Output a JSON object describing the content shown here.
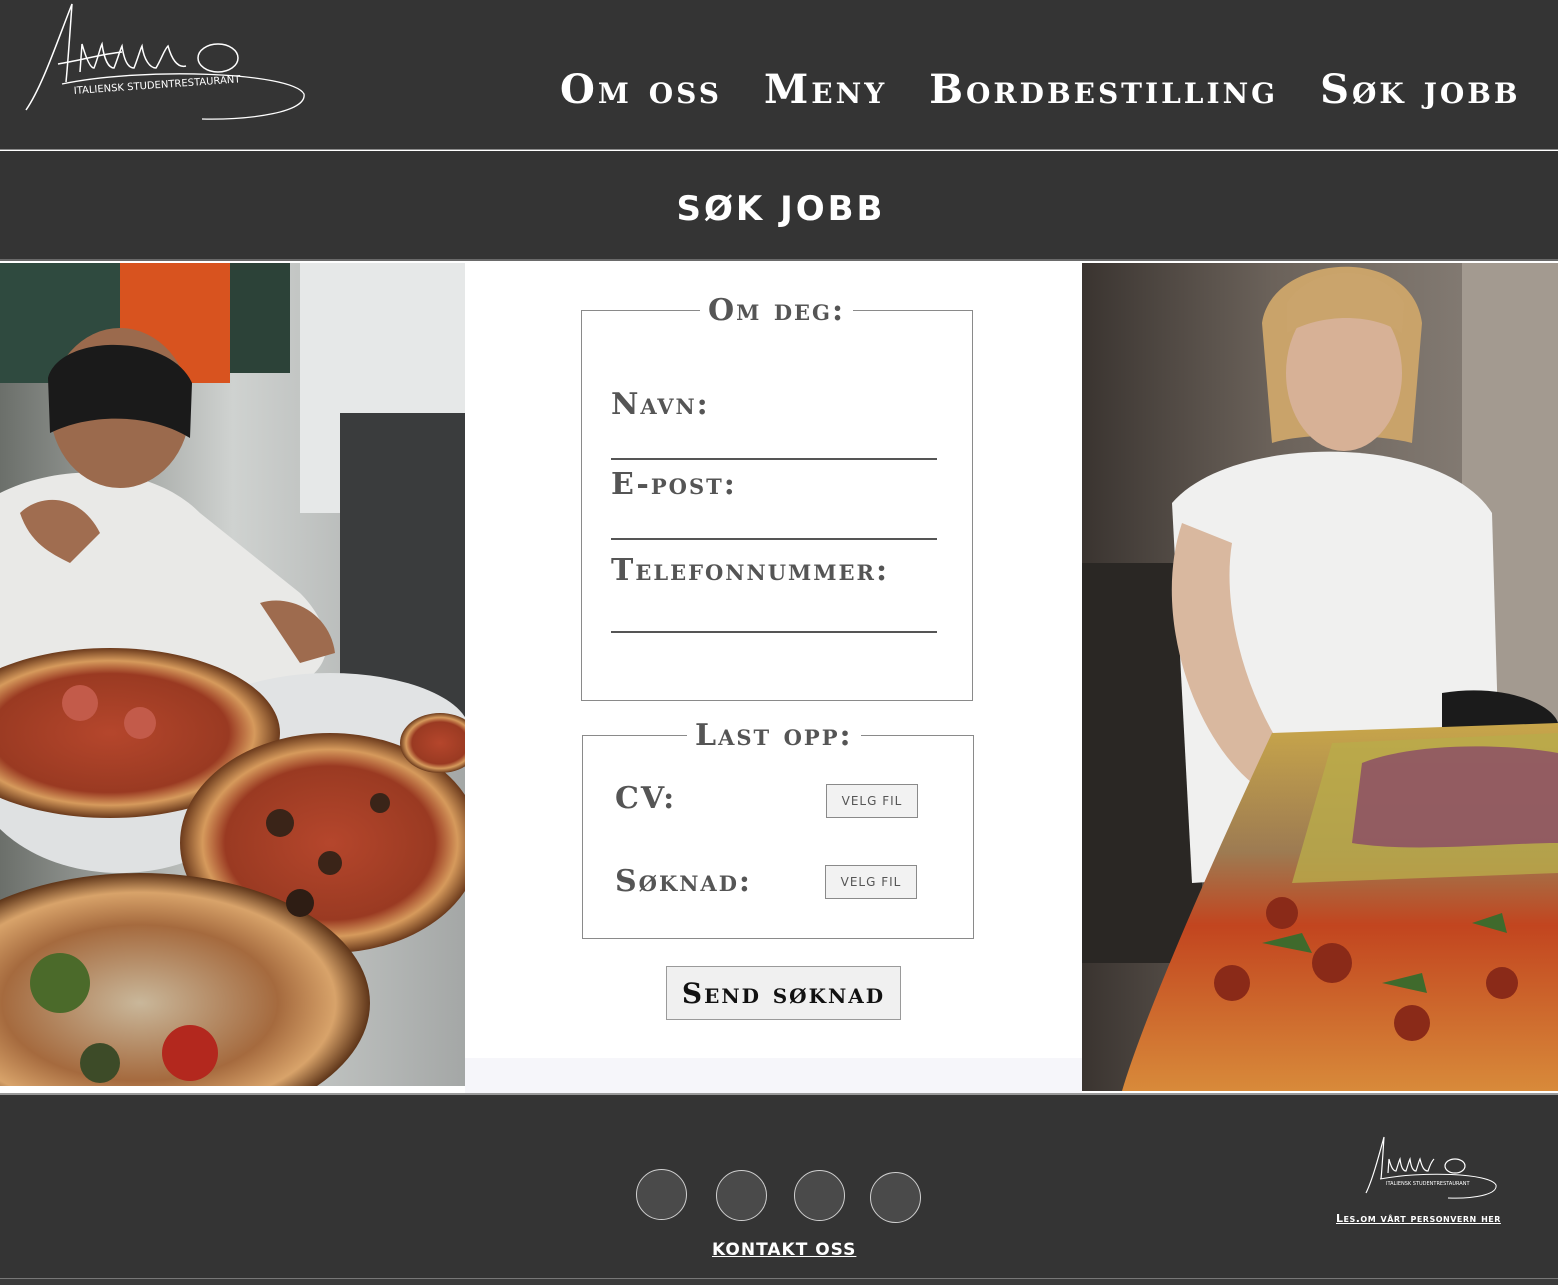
{
  "header": {
    "logo": {
      "brand": "Ahuuuo",
      "tagline": "ITALIENSK STUDENTRESTAURANT"
    },
    "nav": [
      {
        "label": "Om oss"
      },
      {
        "label": "Meny"
      },
      {
        "label": "Bordbestilling"
      },
      {
        "label": "Søk jobb"
      }
    ]
  },
  "page_title": "SØK JOBB",
  "form": {
    "about": {
      "legend": "Om deg:",
      "fields": [
        {
          "label": "Navn:"
        },
        {
          "label": "E-post:"
        },
        {
          "label": "Telefonnummer:"
        }
      ]
    },
    "upload": {
      "legend": "Last opp:",
      "files": [
        {
          "label": "CV:",
          "button": "VELG FIL"
        },
        {
          "label": "Søknad:",
          "button": "VELG FIL"
        }
      ]
    },
    "submit_label": "Send søknad"
  },
  "footer": {
    "social_icons": [
      "social-icon-1",
      "social-icon-2",
      "social-icon-3",
      "social-icon-4"
    ],
    "contact_label": "KONTAKT OSS",
    "privacy_label": "Les.om vårt personvern her",
    "logo": {
      "brand": "Ahuuuo",
      "tagline": "ITALIENSK STUDENTRESTAURANT"
    }
  },
  "colors": {
    "header_bg": "#343434",
    "text_light": "#ffffff",
    "label_gray": "#555555"
  }
}
